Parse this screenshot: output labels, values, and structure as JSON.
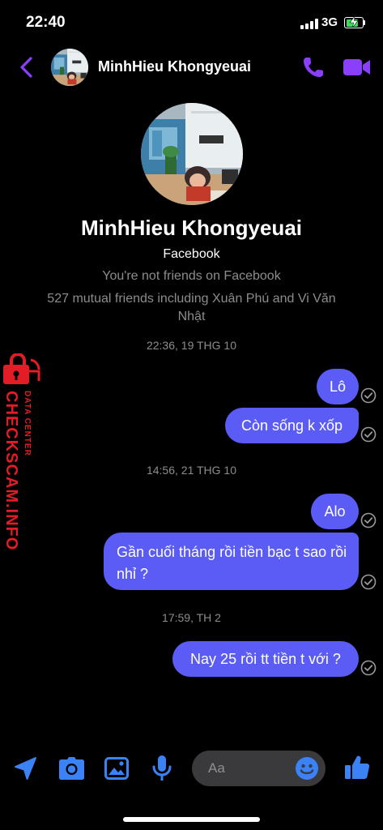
{
  "status_bar": {
    "time": "22:40",
    "network": "3G",
    "battery_level": 0.85
  },
  "header": {
    "contact_name": "MinhHieu Khongyeuai"
  },
  "profile": {
    "name": "MinhHieu Khongyeuai",
    "platform": "Facebook",
    "friend_status": "You're not friends on Facebook",
    "mutual_friends": "527 mutual friends including Xuân Phú and Vi Văn Nhật"
  },
  "conversation": {
    "timestamps": [
      "22:36, 19 THG 10",
      "14:56, 21 THG 10",
      "17:59, TH 2"
    ],
    "messages": [
      {
        "text": "Lô",
        "sender": "me",
        "status": "seen"
      },
      {
        "text": "Còn sống k xốp",
        "sender": "me",
        "status": "seen"
      },
      {
        "text": "Alo",
        "sender": "me",
        "status": "seen"
      },
      {
        "text": "Gần cuối tháng rồi tiền bạc t sao rồi nhỉ ?",
        "sender": "me",
        "status": "seen"
      },
      {
        "text": "Nay 25 rồi tt tiền t với ?",
        "sender": "me",
        "status": "seen"
      }
    ]
  },
  "composer": {
    "placeholder": "Aa",
    "icons": [
      "location-arrow-icon",
      "camera-icon",
      "image-icon",
      "microphone-icon",
      "emoji-icon",
      "thumbs-up-icon"
    ]
  },
  "watermark": {
    "title": "CHECKSCAM.INFO",
    "subtitle": "DATA CENTER"
  },
  "colors": {
    "accent": "#5b5cf6",
    "icon_purple": "#8a3ffc",
    "icon_blue": "#3b82f6",
    "watermark_red": "#e31c25"
  }
}
